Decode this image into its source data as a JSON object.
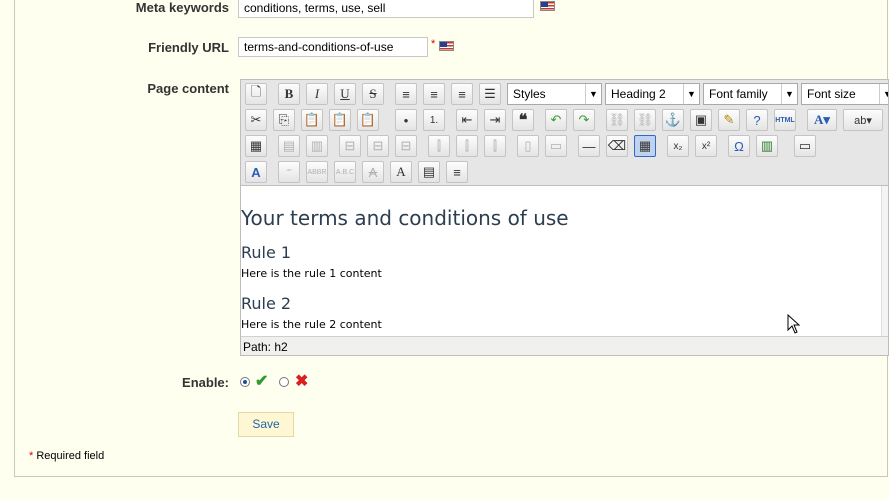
{
  "form": {
    "meta_keywords_label": "Meta keywords",
    "meta_keywords_value": "conditions, terms, use, sell",
    "friendly_url_label": "Friendly URL",
    "friendly_url_value": "terms-and-conditions-of-use",
    "page_content_label": "Page content",
    "enable_label": "Enable:",
    "save_label": "Save",
    "required_star": "*",
    "required_note": "Required field"
  },
  "toolbar": {
    "styles": "Styles",
    "format": "Heading 2",
    "font_family": "Font family",
    "font_size": "Font size"
  },
  "content": {
    "h1": "Your terms and conditions of use",
    "rule1_title": "Rule 1",
    "rule1_text": "Here is the rule 1 content",
    "rule2_title": "Rule 2",
    "rule2_text": "Here is the rule 2 content"
  },
  "status": {
    "path": "Path: h2"
  },
  "enable": {
    "selected": "yes"
  }
}
